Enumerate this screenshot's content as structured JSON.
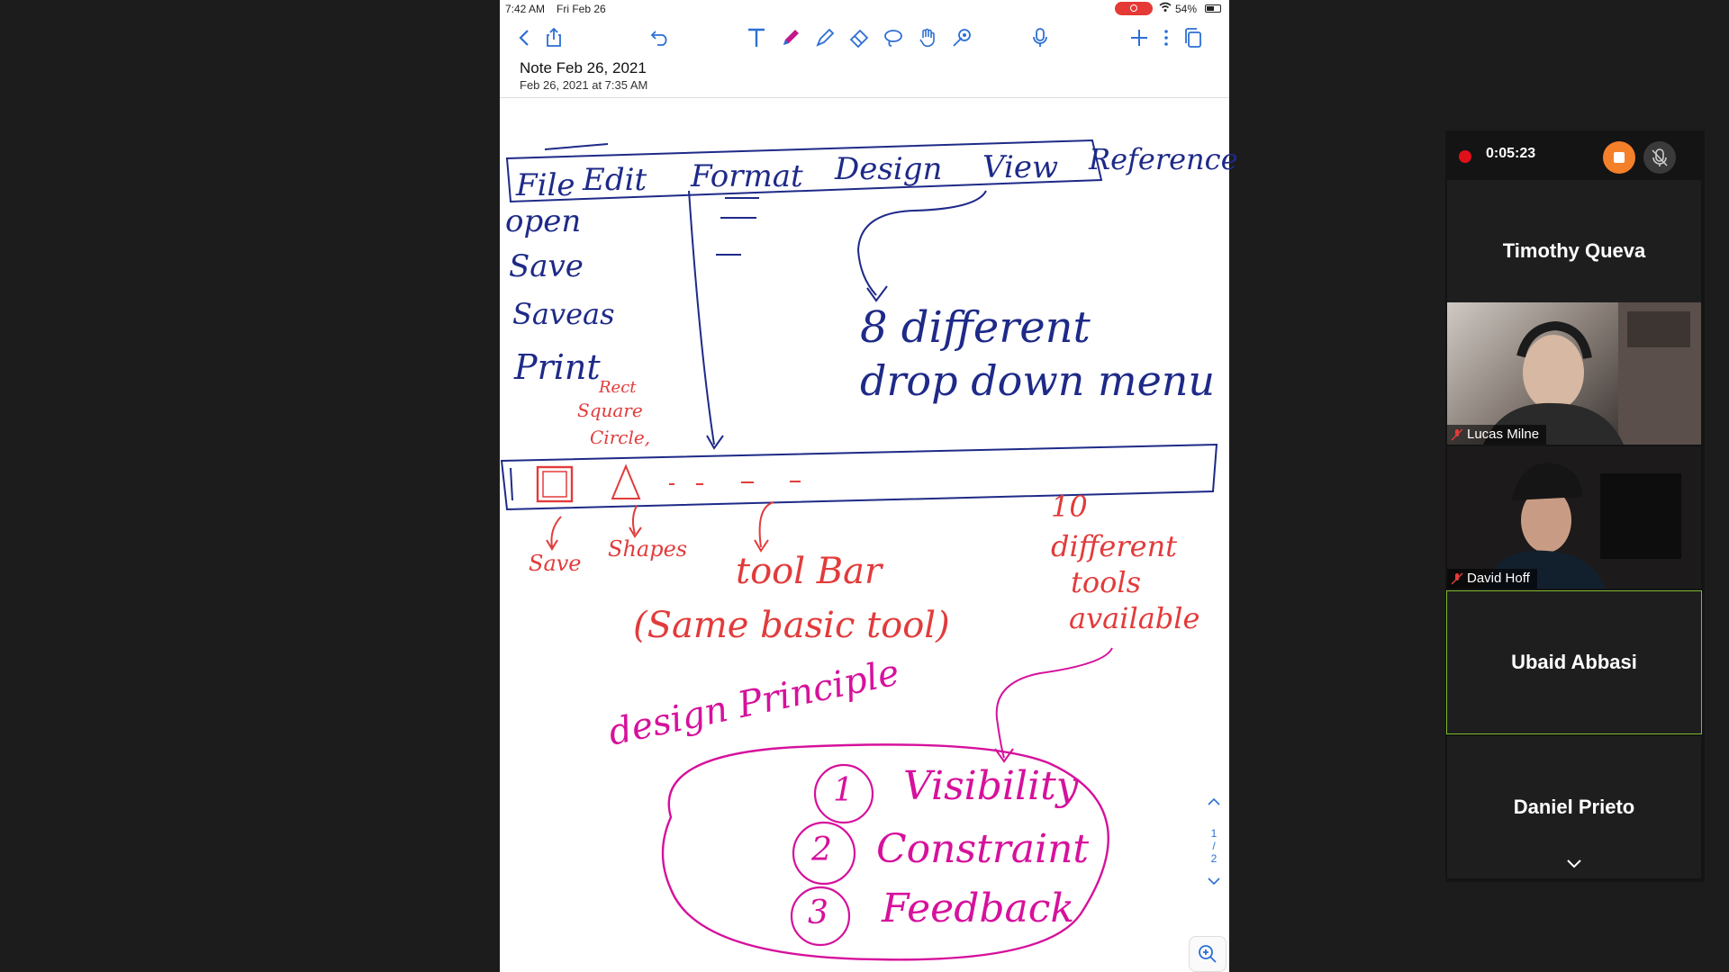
{
  "status_bar": {
    "time": "7:42 AM",
    "date": "Fri Feb 26",
    "battery": "54%"
  },
  "toolbar_icons": [
    "back-icon",
    "share-icon",
    "undo-icon",
    "text-tool-icon",
    "pen-icon",
    "highlighter-icon",
    "eraser-icon",
    "lasso-icon",
    "hand-icon",
    "pen-settings-icon",
    "microphone-icon",
    "add-icon",
    "more-icon",
    "pages-icon"
  ],
  "note": {
    "title": "Note Feb 26, 2021",
    "date": "Feb 26, 2021 at 7:35 AM"
  },
  "handwriting": {
    "menu_bar": [
      "File",
      "Edit",
      "Format",
      "Design",
      "View",
      "Reference"
    ],
    "file_items": [
      "open",
      "Save",
      "Saveas",
      "Print"
    ],
    "different_menu_line1": "8 different",
    "different_menu_line2": "drop down menu",
    "shapes_list": [
      "Rect",
      "Square",
      "Circle,"
    ],
    "save_label": "Save",
    "shapes_label": "Shapes",
    "toolbar_label": "tool Bar",
    "same_basic_tool": "(Same basic tool)",
    "ten_tools": [
      "10",
      "different",
      "tools",
      "available"
    ],
    "design_principle": "design Principle",
    "principles": [
      "Visibility",
      "Constraint",
      "Feedback"
    ],
    "principle_numbers": [
      "1",
      "2",
      "3"
    ]
  },
  "pager": {
    "current": "1",
    "total": "2"
  },
  "zoom": {
    "timer": "0:05:23",
    "participants": [
      {
        "name": "Timothy Queva",
        "video": false
      },
      {
        "name": "Lucas Milne",
        "video": true
      },
      {
        "name": "David Hoff",
        "video": true
      },
      {
        "name": "Ubaid Abbasi",
        "video": false
      },
      {
        "name": "Daniel Prieto",
        "video": false
      }
    ]
  }
}
